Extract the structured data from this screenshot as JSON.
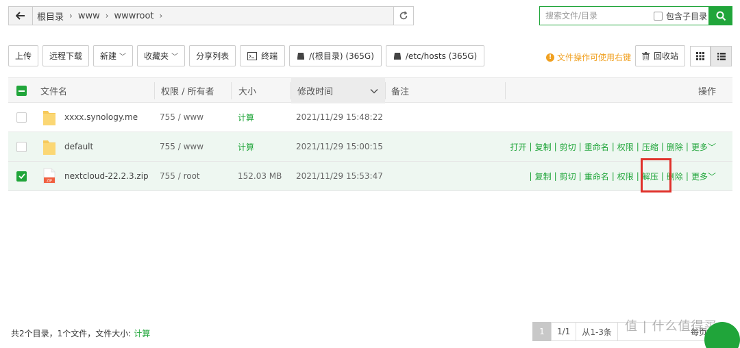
{
  "path": {
    "crumbs": [
      "根目录",
      "www",
      "wwwroot"
    ]
  },
  "search": {
    "placeholder": "搜索文件/目录",
    "include_sub_label": "包含子目录"
  },
  "toolbar": {
    "upload": "上传",
    "remote_download": "远程下载",
    "new": "新建",
    "favorites": "收藏夹",
    "share_list": "分享列表",
    "terminal": "终端",
    "disk_root": "/(根目录) (365G)",
    "disk_hosts": "/etc/hosts (365G)",
    "tip": "文件操作可使用右键",
    "recycle": "回收站"
  },
  "table": {
    "headers": {
      "name": "文件名",
      "perm": "权限 / 所有者",
      "size": "大小",
      "mtime": "修改时间",
      "note": "备注",
      "ops": "操作"
    },
    "rows": [
      {
        "name": "xxxx.synology.me",
        "perm": "755 / www",
        "size": "计算",
        "mtime": "2021/11/29 15:48:22",
        "type": "folder",
        "checked": false
      },
      {
        "name": "default",
        "perm": "755 / www",
        "size": "计算",
        "mtime": "2021/11/29 15:00:15",
        "type": "folder",
        "checked": false
      },
      {
        "name": "nextcloud-22.2.3.zip",
        "perm": "755 / root",
        "size": "152.03 MB",
        "mtime": "2021/11/29 15:53:47",
        "type": "zip",
        "checked": true
      }
    ],
    "ops_folder": [
      "打开",
      "复制",
      "剪切",
      "重命名",
      "权限",
      "压缩",
      "删除",
      "更多"
    ],
    "ops_zip": [
      "复制",
      "剪切",
      "重命名",
      "权限",
      "解压",
      "删除",
      "更多"
    ]
  },
  "footer": {
    "summary": "共2个目录，1个文件，文件大小:",
    "calc": "计算",
    "page_current": "1",
    "page_total": "1/1",
    "range": "从1-3条",
    "per_page_partial": "每页",
    "watermark": "值 | 什么值得买"
  },
  "colors": {
    "accent": "#20a53a",
    "tip": "#f0a020",
    "highlight": "#e0302a"
  }
}
